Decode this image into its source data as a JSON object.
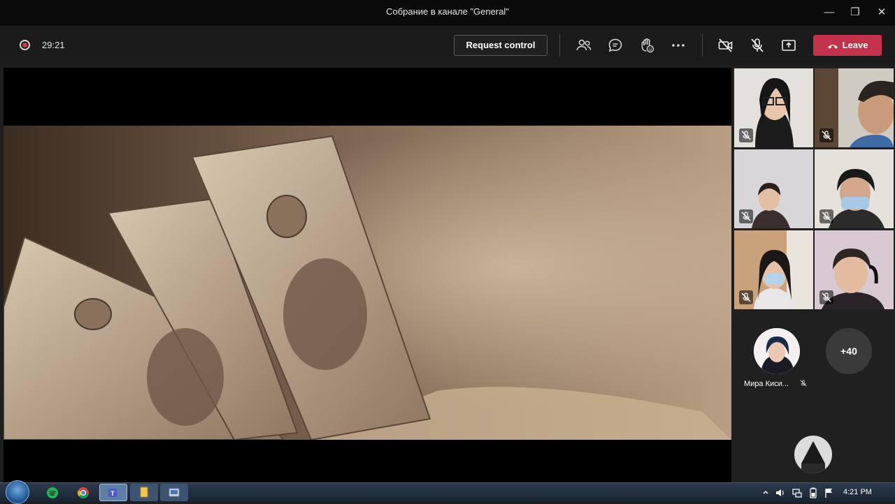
{
  "window": {
    "title": "Собрание в канале \"General\""
  },
  "toolbar": {
    "timer": "29:21",
    "request_control_label": "Request control",
    "leave_label": "Leave",
    "icons": [
      "people-icon",
      "chat-icon",
      "raise-hand-icon",
      "more-icon",
      "camera-off-icon",
      "mic-off-icon",
      "share-icon"
    ]
  },
  "participants": {
    "more_count": "+40",
    "featured_name": "Мира Киси..."
  },
  "taskbar": {
    "clock": "4:21 PM"
  },
  "colors": {
    "leave": "#c4314b",
    "recording": "#d6384a",
    "background": "#1f1f1f"
  }
}
